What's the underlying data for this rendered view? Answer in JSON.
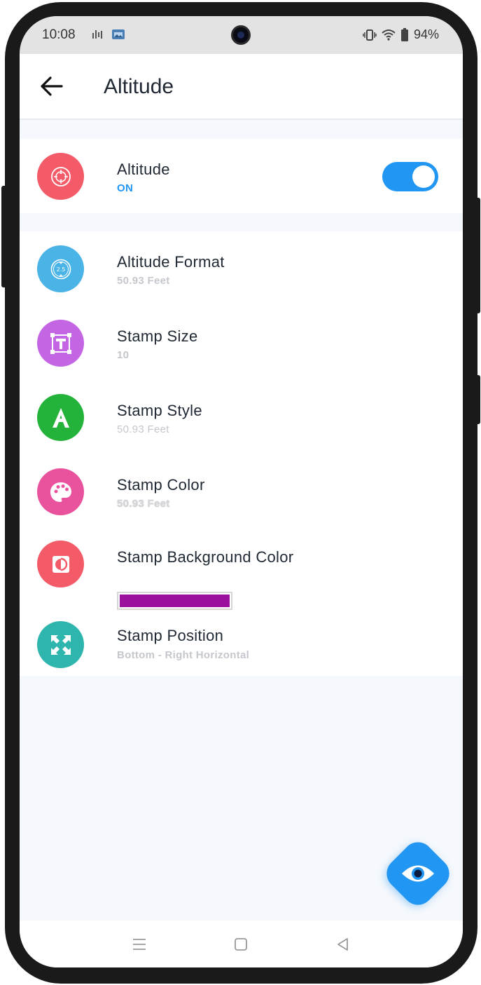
{
  "status_bar": {
    "time": "10:08",
    "battery": "94%"
  },
  "app_bar": {
    "title": "Altitude",
    "back_icon": "arrow-left-icon"
  },
  "toggle_row": {
    "title": "Altitude",
    "state_label": "ON",
    "enabled": true,
    "icon": "altitude-icon",
    "icon_color": "#f45b69",
    "state_color": "#2196f3",
    "toggle_color": "#2196f3"
  },
  "settings": [
    {
      "title": "Altitude Format",
      "subtitle": "50.93 Feet",
      "icon": "altitude-format-icon",
      "icon_color": "#4bb4e6"
    },
    {
      "title": "Stamp Size",
      "subtitle": "10",
      "icon": "text-size-icon",
      "icon_color": "#c466e3"
    },
    {
      "title": "Stamp Style",
      "subtitle": "50.93 Feet",
      "icon": "font-style-icon",
      "icon_color": "#23b33a"
    },
    {
      "title": "Stamp Color",
      "subtitle": "50.93 Feet",
      "icon": "palette-icon",
      "icon_color": "#e9529c"
    },
    {
      "title": "Stamp Background Color",
      "icon": "contrast-icon",
      "icon_color": "#f45b69",
      "swatch_color": "#9b109c"
    },
    {
      "title": "Stamp Position",
      "subtitle": "Bottom - Right Horizontal",
      "icon": "expand-arrows-icon",
      "icon_color": "#2eb5ad"
    }
  ],
  "fab": {
    "icon": "eye-icon",
    "color": "#2196f3"
  },
  "nav_bar": {
    "icons": [
      "menu-icon",
      "home-icon",
      "back-triangle-icon"
    ]
  }
}
